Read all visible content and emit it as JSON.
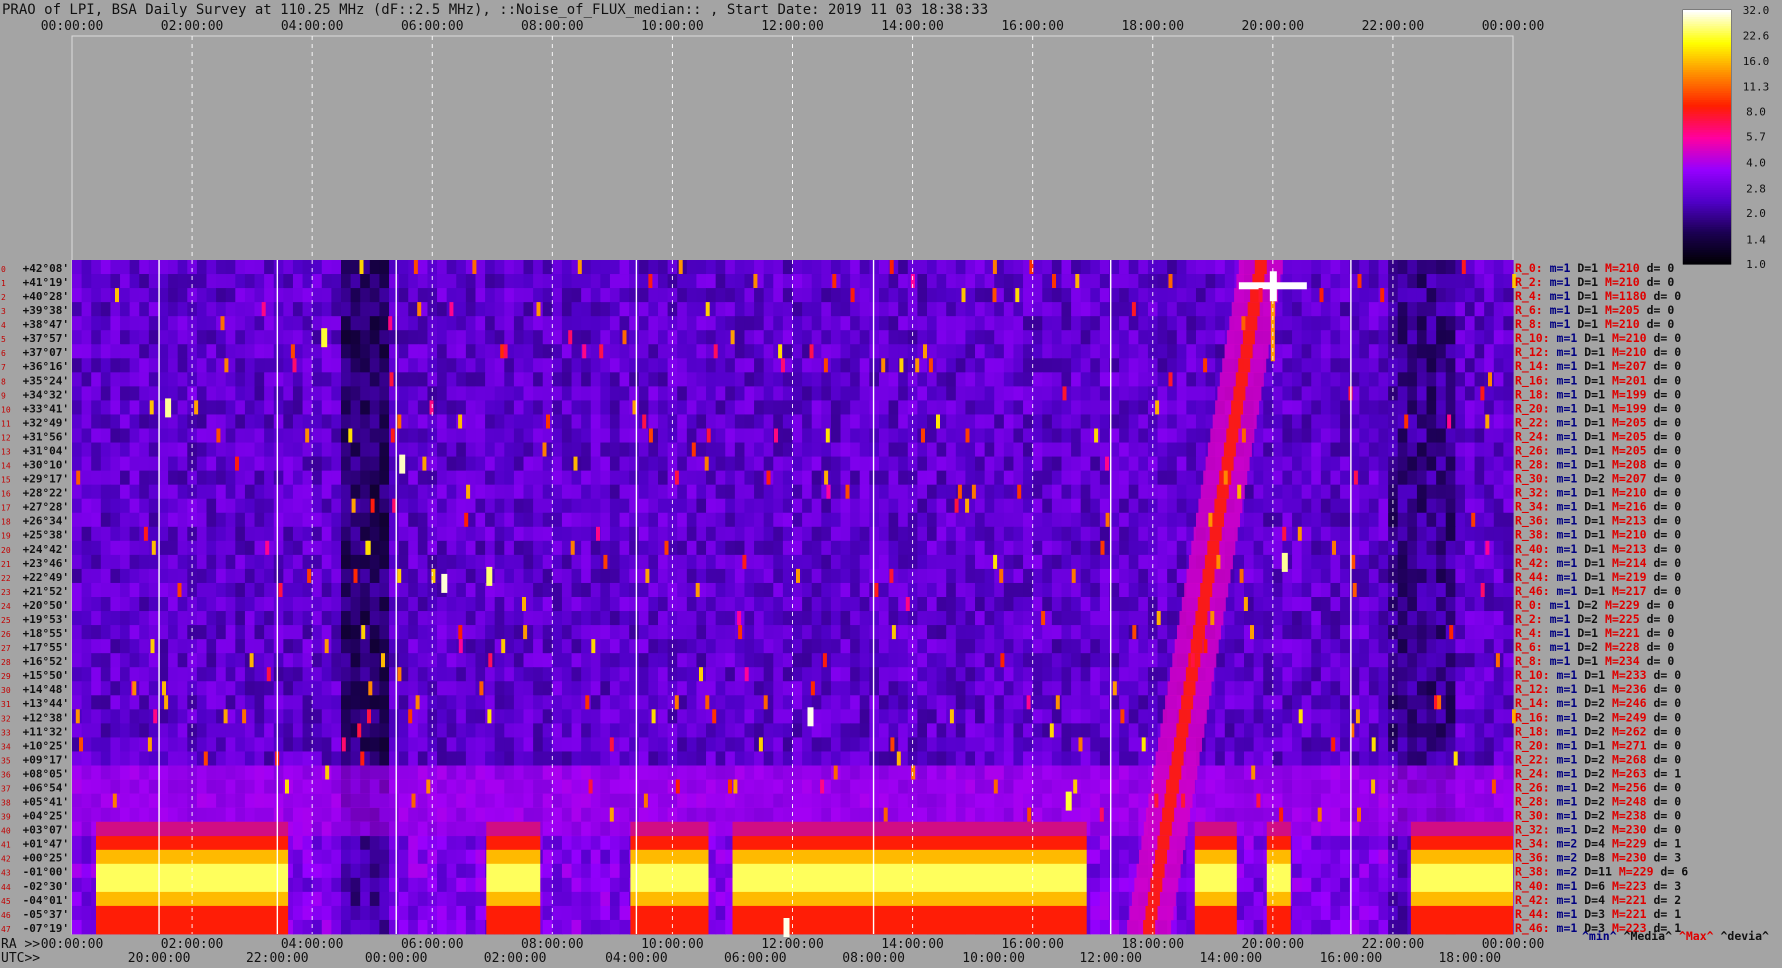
{
  "chart_data": {
    "type": "heatmap",
    "title": "PRAO of LPI, BSA Daily Survey at 110.25 MHz (dF::2.5 MHz), ::Noise_of_FLUX_median:: , Start Date: 2019 11 03 18:38:33",
    "top_ticks": [
      "00:00:00",
      "02:00:00",
      "04:00:00",
      "06:00:00",
      "08:00:00",
      "10:00:00",
      "12:00:00",
      "14:00:00",
      "16:00:00",
      "18:00:00",
      "20:00:00",
      "22:00:00",
      "00:00:00"
    ],
    "ra_prefix": "RA >>",
    "ra_ticks": [
      "00:00:00",
      "02:00:00",
      "04:00:00",
      "06:00:00",
      "08:00:00",
      "10:00:00",
      "12:00:00",
      "14:00:00",
      "16:00:00",
      "18:00:00",
      "20:00:00",
      "22:00:00",
      "00:00:00"
    ],
    "utc_prefix": "UTC>>",
    "utc_ticks": [
      "20:00:00",
      "22:00:00",
      "00:00:00",
      "02:00:00",
      "04:00:00",
      "06:00:00",
      "08:00:00",
      "10:00:00",
      "12:00:00",
      "14:00:00",
      "16:00:00",
      "18:00:00"
    ],
    "declinations": [
      "+42°08'",
      "+41°19'",
      "+40°28'",
      "+39°38'",
      "+38°47'",
      "+37°57'",
      "+37°07'",
      "+36°16'",
      "+35°24'",
      "+34°32'",
      "+33°41'",
      "+32°49'",
      "+31°56'",
      "+31°04'",
      "+30°10'",
      "+29°17'",
      "+28°22'",
      "+27°28'",
      "+26°34'",
      "+25°38'",
      "+24°42'",
      "+23°46'",
      "+22°49'",
      "+21°52'",
      "+20°50'",
      "+19°53'",
      "+18°55'",
      "+17°55'",
      "+16°52'",
      "+15°50'",
      "+14°48'",
      "+13°44'",
      "+12°38'",
      "+11°32'",
      "+10°25'",
      "+09°17'",
      "+08°05'",
      "+06°54'",
      "+05°41'",
      "+04°25'",
      "+03°07'",
      "+01°47'",
      "+00°25'",
      "-01°00'",
      "-02°30'",
      "-04°01'",
      "-05°37'",
      "-07°19'"
    ],
    "colorbar": {
      "ticks": [
        "32.0",
        "22.6",
        "16.0",
        "11.3",
        "8.0",
        "5.7",
        "4.0",
        "2.8",
        "2.0",
        "1.4",
        "1.0"
      ],
      "range": [
        1.0,
        32.0
      ],
      "scale": "log",
      "colors": [
        "#000000",
        "#1a0050",
        "#5000c8",
        "#9600ff",
        "#ff00a0",
        "#ff1e00",
        "#ff8c00",
        "#ffff00",
        "#ffffff"
      ]
    },
    "stats_header": {
      "min": "^min^",
      "median": "^Media^",
      "max": "^Max^",
      "dev": "^devia^"
    },
    "stats": [
      {
        "r": "R_0:",
        "m": "m=1",
        "D": "D=1",
        "M": "M=210",
        "d": "d= 0"
      },
      {
        "r": "R_2:",
        "m": "m=1",
        "D": "D=1",
        "M": "M=210",
        "d": "d= 0"
      },
      {
        "r": "R_4:",
        "m": "m=1",
        "D": "D=1",
        "M": "M=1180",
        "d": "d= 0"
      },
      {
        "r": "R_6:",
        "m": "m=1",
        "D": "D=1",
        "M": "M=205",
        "d": "d= 0"
      },
      {
        "r": "R_8:",
        "m": "m=1",
        "D": "D=1",
        "M": "M=210",
        "d": "d= 0"
      },
      {
        "r": "R_10:",
        "m": "m=1",
        "D": "D=1",
        "M": "M=210",
        "d": "d= 0"
      },
      {
        "r": "R_12:",
        "m": "m=1",
        "D": "D=1",
        "M": "M=210",
        "d": "d= 0"
      },
      {
        "r": "R_14:",
        "m": "m=1",
        "D": "D=1",
        "M": "M=207",
        "d": "d= 0"
      },
      {
        "r": "R_16:",
        "m": "m=1",
        "D": "D=1",
        "M": "M=201",
        "d": "d= 0"
      },
      {
        "r": "R_18:",
        "m": "m=1",
        "D": "D=1",
        "M": "M=199",
        "d": "d= 0"
      },
      {
        "r": "R_20:",
        "m": "m=1",
        "D": "D=1",
        "M": "M=199",
        "d": "d= 0"
      },
      {
        "r": "R_22:",
        "m": "m=1",
        "D": "D=1",
        "M": "M=205",
        "d": "d= 0"
      },
      {
        "r": "R_24:",
        "m": "m=1",
        "D": "D=1",
        "M": "M=205",
        "d": "d= 0"
      },
      {
        "r": "R_26:",
        "m": "m=1",
        "D": "D=1",
        "M": "M=205",
        "d": "d= 0"
      },
      {
        "r": "R_28:",
        "m": "m=1",
        "D": "D=1",
        "M": "M=208",
        "d": "d= 0"
      },
      {
        "r": "R_30:",
        "m": "m=1",
        "D": "D=2",
        "M": "M=207",
        "d": "d= 0"
      },
      {
        "r": "R_32:",
        "m": "m=1",
        "D": "D=1",
        "M": "M=210",
        "d": "d= 0"
      },
      {
        "r": "R_34:",
        "m": "m=1",
        "D": "D=1",
        "M": "M=216",
        "d": "d= 0"
      },
      {
        "r": "R_36:",
        "m": "m=1",
        "D": "D=1",
        "M": "M=213",
        "d": "d= 0"
      },
      {
        "r": "R_38:",
        "m": "m=1",
        "D": "D=1",
        "M": "M=210",
        "d": "d= 0"
      },
      {
        "r": "R_40:",
        "m": "m=1",
        "D": "D=1",
        "M": "M=213",
        "d": "d= 0"
      },
      {
        "r": "R_42:",
        "m": "m=1",
        "D": "D=1",
        "M": "M=214",
        "d": "d= 0"
      },
      {
        "r": "R_44:",
        "m": "m=1",
        "D": "D=1",
        "M": "M=219",
        "d": "d= 0"
      },
      {
        "r": "R_46:",
        "m": "m=1",
        "D": "D=1",
        "M": "M=217",
        "d": "d= 0"
      },
      {
        "r": "R_0:",
        "m": "m=1",
        "D": "D=2",
        "M": "M=229",
        "d": "d= 0"
      },
      {
        "r": "R_2:",
        "m": "m=1",
        "D": "D=2",
        "M": "M=225",
        "d": "d= 0"
      },
      {
        "r": "R_4:",
        "m": "m=1",
        "D": "D=1",
        "M": "M=221",
        "d": "d= 0"
      },
      {
        "r": "R_6:",
        "m": "m=1",
        "D": "D=2",
        "M": "M=228",
        "d": "d= 0"
      },
      {
        "r": "R_8:",
        "m": "m=1",
        "D": "D=1",
        "M": "M=234",
        "d": "d= 0"
      },
      {
        "r": "R_10:",
        "m": "m=1",
        "D": "D=1",
        "M": "M=233",
        "d": "d= 0"
      },
      {
        "r": "R_12:",
        "m": "m=1",
        "D": "D=1",
        "M": "M=236",
        "d": "d= 0"
      },
      {
        "r": "R_14:",
        "m": "m=1",
        "D": "D=2",
        "M": "M=246",
        "d": "d= 0"
      },
      {
        "r": "R_16:",
        "m": "m=1",
        "D": "D=2",
        "M": "M=249",
        "d": "d= 0"
      },
      {
        "r": "R_18:",
        "m": "m=1",
        "D": "D=2",
        "M": "M=262",
        "d": "d= 0"
      },
      {
        "r": "R_20:",
        "m": "m=1",
        "D": "D=1",
        "M": "M=271",
        "d": "d= 0"
      },
      {
        "r": "R_22:",
        "m": "m=1",
        "D": "D=2",
        "M": "M=268",
        "d": "d= 0"
      },
      {
        "r": "R_24:",
        "m": "m=1",
        "D": "D=2",
        "M": "M=263",
        "d": "d= 1"
      },
      {
        "r": "R_26:",
        "m": "m=1",
        "D": "D=2",
        "M": "M=256",
        "d": "d= 0"
      },
      {
        "r": "R_28:",
        "m": "m=1",
        "D": "D=2",
        "M": "M=248",
        "d": "d= 0"
      },
      {
        "r": "R_30:",
        "m": "m=1",
        "D": "D=2",
        "M": "M=238",
        "d": "d= 0"
      },
      {
        "r": "R_32:",
        "m": "m=1",
        "D": "D=2",
        "M": "M=230",
        "d": "d= 0"
      },
      {
        "r": "R_34:",
        "m": "m=2",
        "D": "D=4",
        "M": "M=229",
        "d": "d= 1"
      },
      {
        "r": "R_36:",
        "m": "m=2",
        "D": "D=8",
        "M": "M=230",
        "d": "d= 3"
      },
      {
        "r": "R_38:",
        "m": "m=2",
        "D": "D=11",
        "M": "M=229",
        "d": "d= 6"
      },
      {
        "r": "R_40:",
        "m": "m=1",
        "D": "D=6",
        "M": "M=223",
        "d": "d= 3"
      },
      {
        "r": "R_42:",
        "m": "m=1",
        "D": "D=4",
        "M": "M=221",
        "d": "d= 2"
      },
      {
        "r": "R_44:",
        "m": "m=1",
        "D": "D=3",
        "M": "M=221",
        "d": "d= 1"
      },
      {
        "r": "R_46:",
        "m": "m=1",
        "D": "D=3",
        "M": "M=223",
        "d": "d= 1"
      }
    ]
  }
}
